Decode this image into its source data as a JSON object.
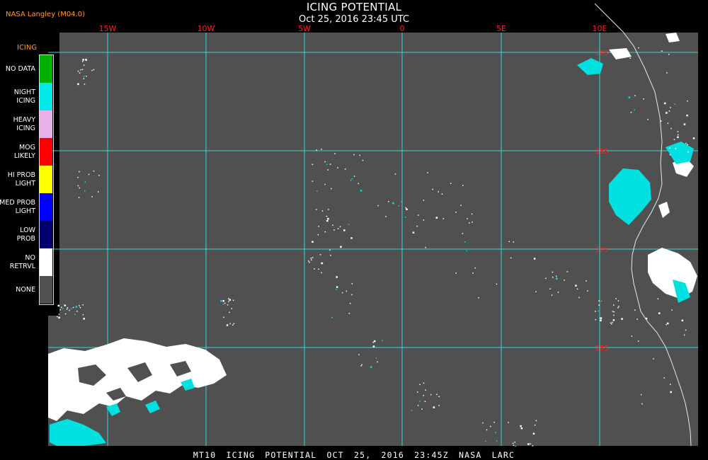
{
  "header": {
    "credit": "NASA Langley (M04.0)",
    "title": "ICING POTENTIAL",
    "datetime": "Oct 25, 2016 23:45 UTC"
  },
  "legend": {
    "title": "ICING",
    "items": [
      {
        "label": "NO DATA",
        "color": "#00b000"
      },
      {
        "label": "NIGHT\nICING",
        "color": "#00e8e8"
      },
      {
        "label": "HEAVY\nICING",
        "color": "#e8b0e8"
      },
      {
        "label": "MOG\nLIKELY",
        "color": "#ff0000"
      },
      {
        "label": "HI PROB\nLIGHT",
        "color": "#ffff00"
      },
      {
        "label": "MED PROB\nLIGHT",
        "color": "#0000ff"
      },
      {
        "label": "LOW\nPROB",
        "color": "#00006e"
      },
      {
        "label": "NO\nRETRVL",
        "color": "#ffffff"
      },
      {
        "label": "NONE",
        "color": "#505050"
      }
    ]
  },
  "map": {
    "background": "#505050",
    "grid_color": "#33d6d6",
    "lat_label_color": "#ff2020",
    "lon_label_color": "#ff2020",
    "lon_labels": [
      "15W",
      "10W",
      "5W",
      "0",
      "5E",
      "10E"
    ],
    "lat_labels": [
      "10S",
      "15S",
      "20S",
      "25S"
    ]
  },
  "footer": {
    "text": "MT10 ICING POTENTIAL OCT 25, 2016 23:45Z NASA LARC"
  }
}
